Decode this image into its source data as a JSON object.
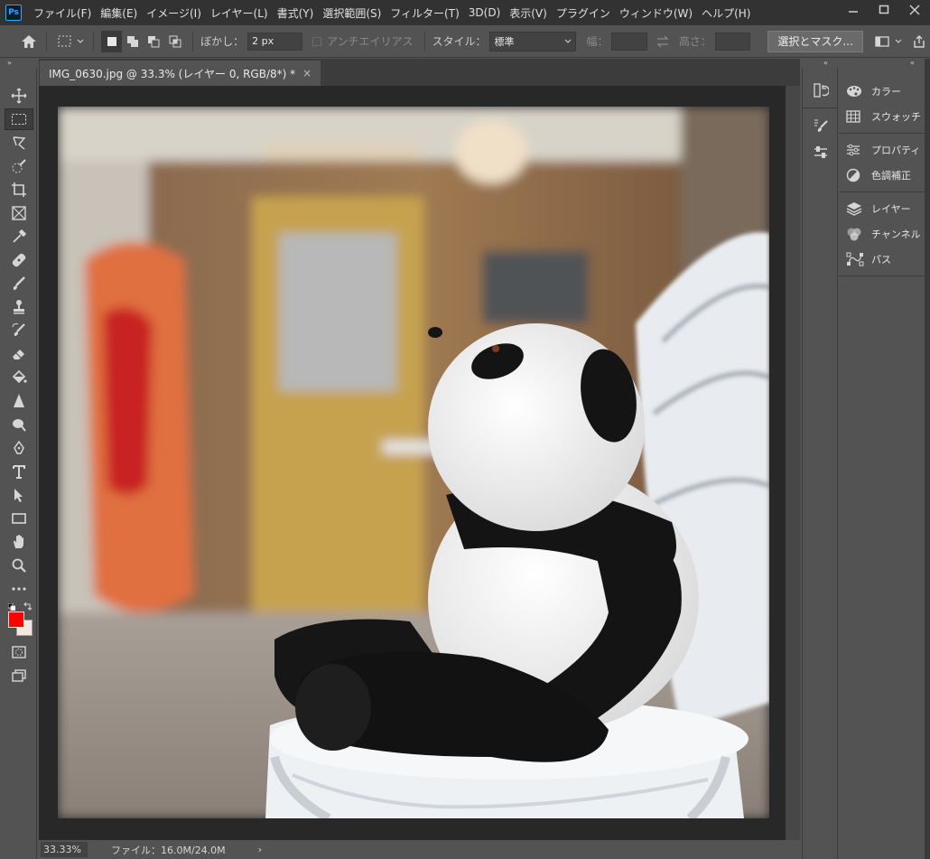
{
  "menubar": {
    "logo": "Ps",
    "items": [
      "ファイル(F)",
      "編集(E)",
      "イメージ(I)",
      "レイヤー(L)",
      "書式(Y)",
      "選択範囲(S)",
      "フィルター(T)",
      "3D(D)",
      "表示(V)",
      "プラグイン",
      "ウィンドウ(W)",
      "ヘルプ(H)"
    ]
  },
  "options": {
    "feather_label": "ぼかし：",
    "feather_value": "2 px",
    "antialias_label": "アンチエイリアス",
    "style_label": "スタイル：",
    "style_value": "標準",
    "width_label": "幅：",
    "height_label": "高さ：",
    "mask_button": "選択とマスク..."
  },
  "document": {
    "tab_title": "IMG_0630.jpg @ 33.3% (レイヤー 0, RGB/8*) *",
    "close": "×"
  },
  "status": {
    "zoom": "33.33%",
    "file_info": "ファイル：16.0M/24.0M",
    "arrow": "›"
  },
  "panels": {
    "group1": [
      "カラー",
      "スウォッチ"
    ],
    "group2": [
      "プロパティ",
      "色調補正"
    ],
    "group3": [
      "レイヤー",
      "チャンネル",
      "パス"
    ]
  },
  "colors": {
    "foreground": "#ff0000",
    "background": "#f4e6e0",
    "accent": "#31a8ff"
  }
}
